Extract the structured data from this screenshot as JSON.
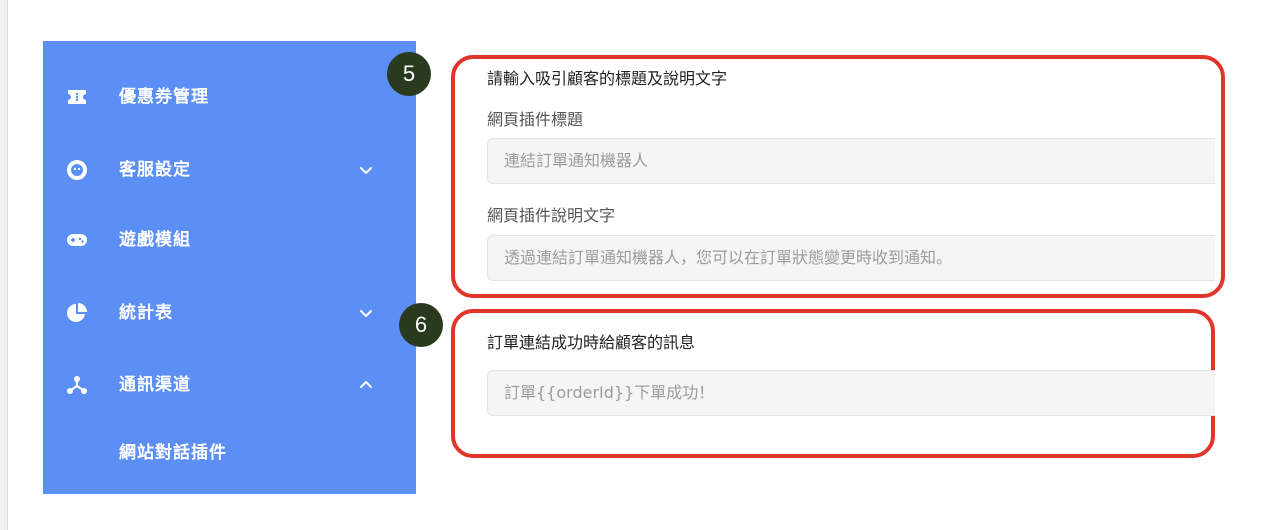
{
  "sidebar": {
    "items": [
      {
        "label": "優惠券管理",
        "icon": "ticket-icon",
        "chevron": ""
      },
      {
        "label": "客服設定",
        "icon": "support-agent-icon",
        "chevron": "down"
      },
      {
        "label": "遊戲模組",
        "icon": "gamepad-icon",
        "chevron": ""
      },
      {
        "label": "統計表",
        "icon": "pie-chart-icon",
        "chevron": "down"
      },
      {
        "label": "通訊渠道",
        "icon": "channel-hub-icon",
        "chevron": "up"
      }
    ],
    "subitem": {
      "label": "網站對話插件"
    },
    "colors": {
      "background": "#5b8ff6",
      "text": "#ffffff"
    }
  },
  "badges": [
    "5",
    "6"
  ],
  "section5": {
    "title": "請輸入吸引顧客的標題及說明文字",
    "widget_title_label": "網頁插件標題",
    "widget_title_placeholder": "連結訂單通知機器人",
    "widget_desc_label": "網頁插件說明文字",
    "widget_desc_placeholder": "透過連結訂單通知機器人，您可以在訂單狀態變更時收到通知。"
  },
  "section6": {
    "title": "訂單連結成功時給顧客的訊息",
    "message_placeholder": "訂單{{orderId}}下單成功！"
  },
  "colors": {
    "highlight": "#e0352b",
    "badge": "#2a3a1e"
  }
}
